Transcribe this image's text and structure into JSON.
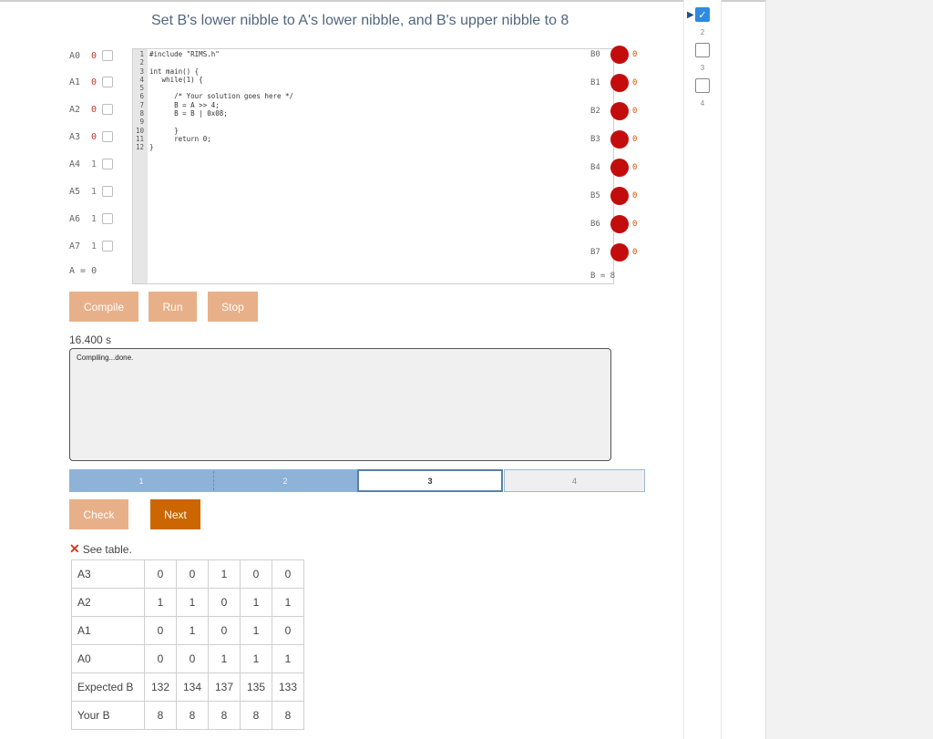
{
  "title": "Set B's lower nibble to A's lower nibble, and B's upper nibble to 8",
  "inputs": [
    {
      "label": "A0",
      "value": "0"
    },
    {
      "label": "A1",
      "value": "0"
    },
    {
      "label": "A2",
      "value": "0"
    },
    {
      "label": "A3",
      "value": "0"
    },
    {
      "label": "A4",
      "value": "1"
    },
    {
      "label": "A5",
      "value": "1"
    },
    {
      "label": "A6",
      "value": "1"
    },
    {
      "label": "A7",
      "value": "1"
    }
  ],
  "a_value": "A = 0",
  "code": {
    "line_numbers": [
      "1",
      "2",
      "3",
      "4",
      "5",
      "6",
      "7",
      "8",
      "9",
      "10",
      "11",
      "12"
    ],
    "lines": [
      "#include \"RIMS.h\"",
      "",
      "int main() {",
      "   while(1) {",
      "",
      "      /* Your solution goes here */",
      "      B = A >> 4;",
      "      B = B | 0x08;",
      "",
      "      }",
      "      return 0;",
      "}"
    ]
  },
  "outputs": [
    {
      "label": "B0",
      "value": "0"
    },
    {
      "label": "B1",
      "value": "0"
    },
    {
      "label": "B2",
      "value": "0"
    },
    {
      "label": "B3",
      "value": "0"
    },
    {
      "label": "B4",
      "value": "0"
    },
    {
      "label": "B5",
      "value": "0"
    },
    {
      "label": "B6",
      "value": "0"
    },
    {
      "label": "B7",
      "value": "0"
    }
  ],
  "b_value": "B = 8",
  "buttons": {
    "compile": "Compile",
    "run": "Run",
    "stop": "Stop",
    "check": "Check",
    "next": "Next"
  },
  "timer": "16.400 s",
  "console_text": "Compiling...done.",
  "progress": {
    "segments": [
      "1",
      "2",
      "3",
      "4"
    ],
    "current": "3"
  },
  "result_text": "See table.",
  "table": {
    "rows": [
      {
        "label": "A3",
        "cells": [
          "0",
          "0",
          "1",
          "0",
          "0"
        ]
      },
      {
        "label": "A2",
        "cells": [
          "1",
          "1",
          "0",
          "1",
          "1"
        ]
      },
      {
        "label": "A1",
        "cells": [
          "0",
          "1",
          "0",
          "1",
          "0"
        ]
      },
      {
        "label": "A0",
        "cells": [
          "0",
          "0",
          "1",
          "1",
          "1"
        ]
      },
      {
        "label": "Expected B",
        "cells": [
          "132",
          "134",
          "137",
          "135",
          "133"
        ]
      },
      {
        "label": "Your B",
        "cells": [
          "8",
          "8",
          "8",
          "8",
          "8"
        ]
      }
    ]
  },
  "steps": [
    "2",
    "3",
    "4"
  ],
  "colors": {
    "led_off": "#c30d0d",
    "button_light": "#e8b088",
    "button_dark": "#cc6600",
    "progress_done": "#8fb3d8"
  }
}
